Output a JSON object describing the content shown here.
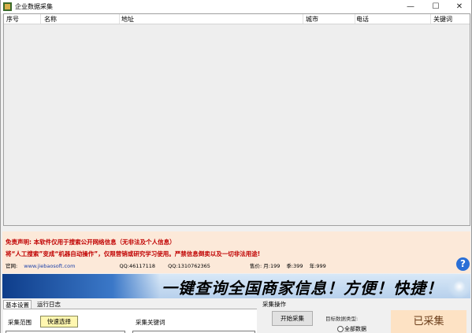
{
  "window": {
    "title": "企业数据采集",
    "min_glyph": "—",
    "max_glyph": "☐",
    "close_glyph": "✕"
  },
  "grid": {
    "columns": [
      "序号",
      "名称",
      "地址",
      "城市",
      "电话",
      "关键词"
    ],
    "rows": []
  },
  "notice": {
    "disclaimer": "免责声明: 本软件仅用于搜索公开网络信息（无非法及个人信息）",
    "usage": "将“人工搜索”变成“机器自动操作”，仅限营销或研究学习使用。严禁信息倒卖以及一切非法用途!",
    "website_label": "官网:",
    "website": "www.jiebaosoft.com",
    "qq1_label": "QQ:",
    "qq1": "46117118",
    "qq2_label": "QQ:",
    "qq2": "1310762365",
    "price_label": "售价:",
    "price_month": "月:199",
    "price_season": "季:399",
    "price_year": "年:999",
    "help_glyph": "?"
  },
  "banner": {
    "slogan": "一键查询全国商家信息！方便！快捷！"
  },
  "panel": {
    "tabs": [
      "基本设置",
      "运行日志"
    ],
    "scope_label": "采集范围",
    "quick_select_label": "快速选择",
    "keyword_label": "采集关键词",
    "scope_value": "",
    "keyword_value": "",
    "group_label": "采集操作",
    "start_label": "开始采集",
    "target_label": "目标数据类型:",
    "radio_all_label": "全部数据",
    "collected_label": "已采集"
  },
  "colors": {
    "accent_red": "#c00000",
    "notice_bg": "#fce9d9",
    "highlight_yellow": "#fff7b0"
  }
}
